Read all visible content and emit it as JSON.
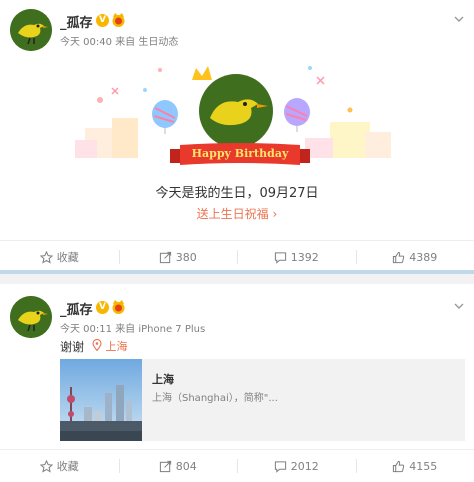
{
  "post1": {
    "username": "_孤存",
    "time": "今天 00:40",
    "source_prefix": "来自",
    "source": "生日动态",
    "banner_label": "Happy Birthday",
    "birthday_text": "今天是我的生日，09月27日",
    "birthday_link": "送上生日祝福",
    "actions": {
      "favorite": "收藏",
      "repost": "380",
      "comment": "1392",
      "like": "4389"
    }
  },
  "post2": {
    "username": "_孤存",
    "time": "今天 00:11",
    "source_prefix": "来自",
    "source": "iPhone 7 Plus",
    "text": "谢谢",
    "location": "上海",
    "link_title": "上海",
    "link_desc": "上海（Shanghai），简称\"...",
    "actions": {
      "favorite": "收藏",
      "repost": "804",
      "comment": "2012",
      "like": "4155"
    }
  },
  "colors": {
    "accent": "#eb7350",
    "vip": "#f7b600",
    "separator": "#bed9ec"
  }
}
